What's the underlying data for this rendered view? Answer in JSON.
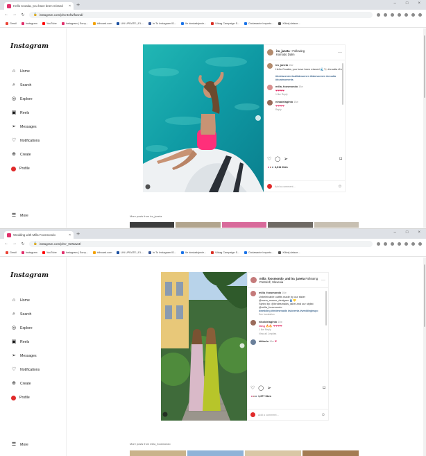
{
  "browser": {
    "nav_back": "←",
    "nav_forward": "→",
    "nav_reload": "↻",
    "new_tab": "+",
    "window_controls": [
      "–",
      "□",
      "×"
    ]
  },
  "bookmarks": [
    {
      "label": "Gmail",
      "color": "#ea4335"
    },
    {
      "label": "Instagram",
      "color": "#e1306c"
    },
    {
      "label": "YouTube",
      "color": "#ff0000"
    },
    {
      "label": "Instagram | Sorry...",
      "color": "#e1306c"
    },
    {
      "label": "bilboard.com",
      "color": "#f4a100"
    },
    {
      "label": "UN UPDATE | EL...",
      "color": "#1a4fa0"
    },
    {
      "label": "In To Instagram ID...",
      "color": "#3b5998"
    },
    {
      "label": "Ile dowiadujecie...",
      "color": "#1a73e8"
    },
    {
      "label": "Uldag Campaign S...",
      "color": "#d93025"
    },
    {
      "label": "Dodawanie Importo...",
      "color": "#1a73e8"
    },
    {
      "label": "Kliknij dalsze...",
      "color": "#555555"
    }
  ],
  "sidebar": {
    "logo": "Instagram",
    "items": [
      {
        "label": "Home",
        "icon": "⌂"
      },
      {
        "label": "Search",
        "icon": "⌕"
      },
      {
        "label": "Explore",
        "icon": "◎"
      },
      {
        "label": "Reels",
        "icon": "▣"
      },
      {
        "label": "Messages",
        "icon": "➢"
      },
      {
        "label": "Notifications",
        "icon": "♡"
      },
      {
        "label": "Create",
        "icon": "⊕"
      },
      {
        "label": "Profile",
        "icon": ""
      }
    ],
    "more_icon": "☰",
    "more": "More"
  },
  "screen1": {
    "tab_title": "Hello Croatia, you have been missed",
    "url": "instagram.com/p/Cr4nfw/fwsnd/",
    "post": {
      "user": "ira_janeta",
      "follow": "• Following",
      "location": "Komodo Dalm",
      "caption_user": "ira_janeta",
      "caption_time": "10w",
      "caption": "Hello Croatia, you have been missed 🌊🐚 #croatia #hr",
      "hashtags": "#boldwomen #saltlakwomen #fakewomen #croatia #boatmoments",
      "comments": [
        {
          "user": "milla_foosmondo",
          "time": "10w",
          "text": "❤❤❤❤",
          "meta": "1 like   Reply"
        },
        {
          "user": "ninadelaginto",
          "time": "10w",
          "text": "❤❤❤❤",
          "meta": "Reply"
        }
      ],
      "likes": "4,611 likes",
      "add_comment": "Add a comment...",
      "more_posts": "More posts from ira_janeta"
    }
  },
  "screen2": {
    "tab_title": "Wedding with Milla Foosmondo",
    "url": "instagram.com/p/Cr_0eMaw3/",
    "post": {
      "user": "milla_foosmondo_and ira_janeta",
      "follow": "Following",
      "location": "Portorož, Slovenia",
      "caption_user": "milla_foosmondo",
      "caption_time": "10w",
      "caption": "Unbeleivable outfits made by our sister @nana_mosso_designer 👗💛",
      "caption2": "Styled by: @bridesmaids_label and our stylist @milla_foosmondo",
      "hashtags": "#wedding #bridesmaids #slovenia #weddinginspo",
      "see_translation": "See translation",
      "comments": [
        {
          "user": "nikoldelaginto",
          "time": "10w",
          "text": "Omg 🔥🔥 ❤❤❤❤",
          "meta": "1 like   Reply",
          "view": "View all 1 replies"
        },
        {
          "user": "kikka.lu",
          "time": "10w",
          "text": "❤",
          "meta": ""
        }
      ],
      "likes": "1,377 likes",
      "add_comment": "Add a comment...",
      "more_posts": "More posts from milla_foosmondo"
    }
  }
}
